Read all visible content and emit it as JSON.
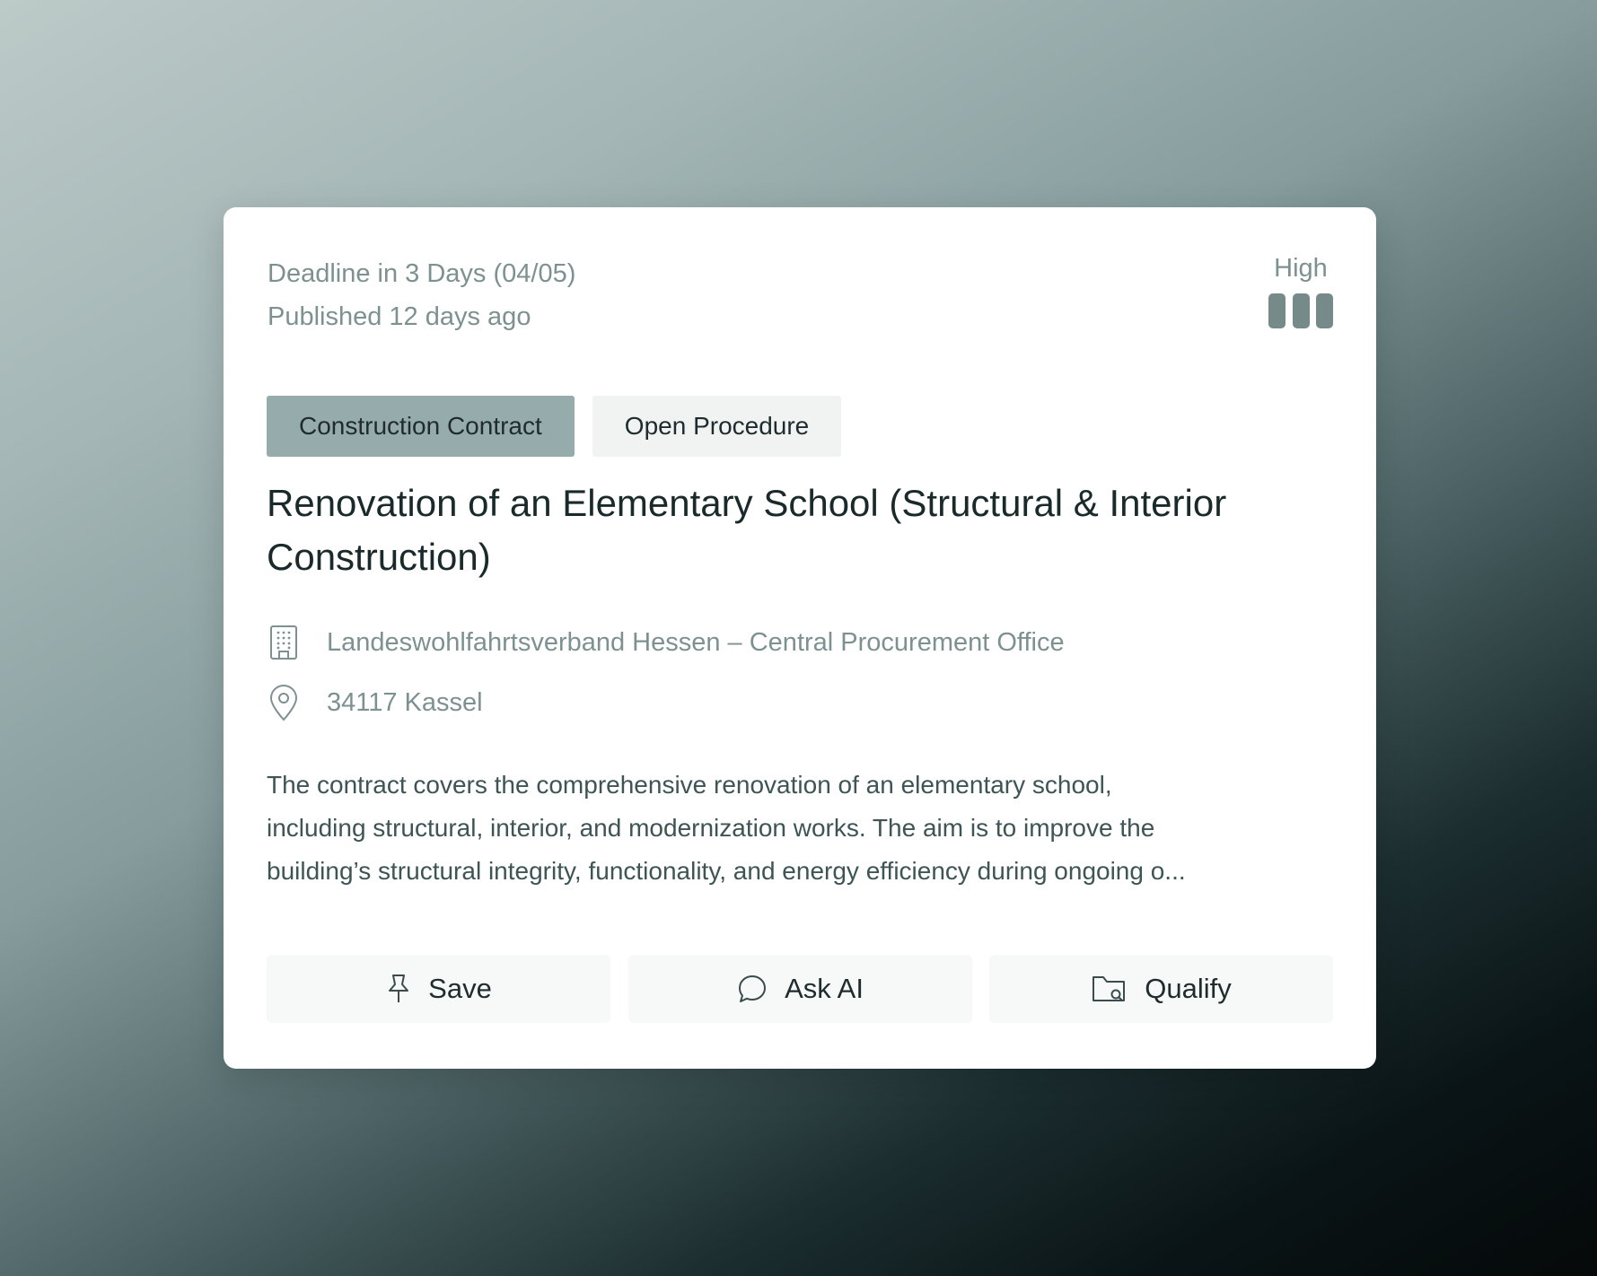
{
  "tender": {
    "deadline": "Deadline in 3 Days (04/05)",
    "published": "Published 12 days ago",
    "priority": {
      "label": "High",
      "level": 3,
      "max": 3,
      "bar_color": "#768a8a"
    },
    "tags": [
      {
        "label": "Construction Contract",
        "style": "primary",
        "color": "#96abac"
      },
      {
        "label": "Open Procedure",
        "style": "secondary",
        "color": "#f1f3f3"
      }
    ],
    "title": "Renovation of an Elementary School (Structural & Interior Construction)",
    "organization": {
      "icon": "building-icon",
      "text": "Landeswohlfahrtsverband Hessen – Central Procurement Office"
    },
    "location": {
      "icon": "map-pin-icon",
      "text": "34117 Kassel"
    },
    "description_lines": [
      "The contract covers the comprehensive renovation of an elementary school,",
      "including structural, interior, and modernization works. The aim is to improve the",
      "building’s structural integrity, functionality, and energy efficiency during ongoing o..."
    ]
  },
  "actions": [
    {
      "label": "Save",
      "icon": "pin-icon"
    },
    {
      "label": "Ask AI",
      "icon": "chat-bubble-icon"
    },
    {
      "label": "Qualify",
      "icon": "folder-search-icon"
    }
  ]
}
